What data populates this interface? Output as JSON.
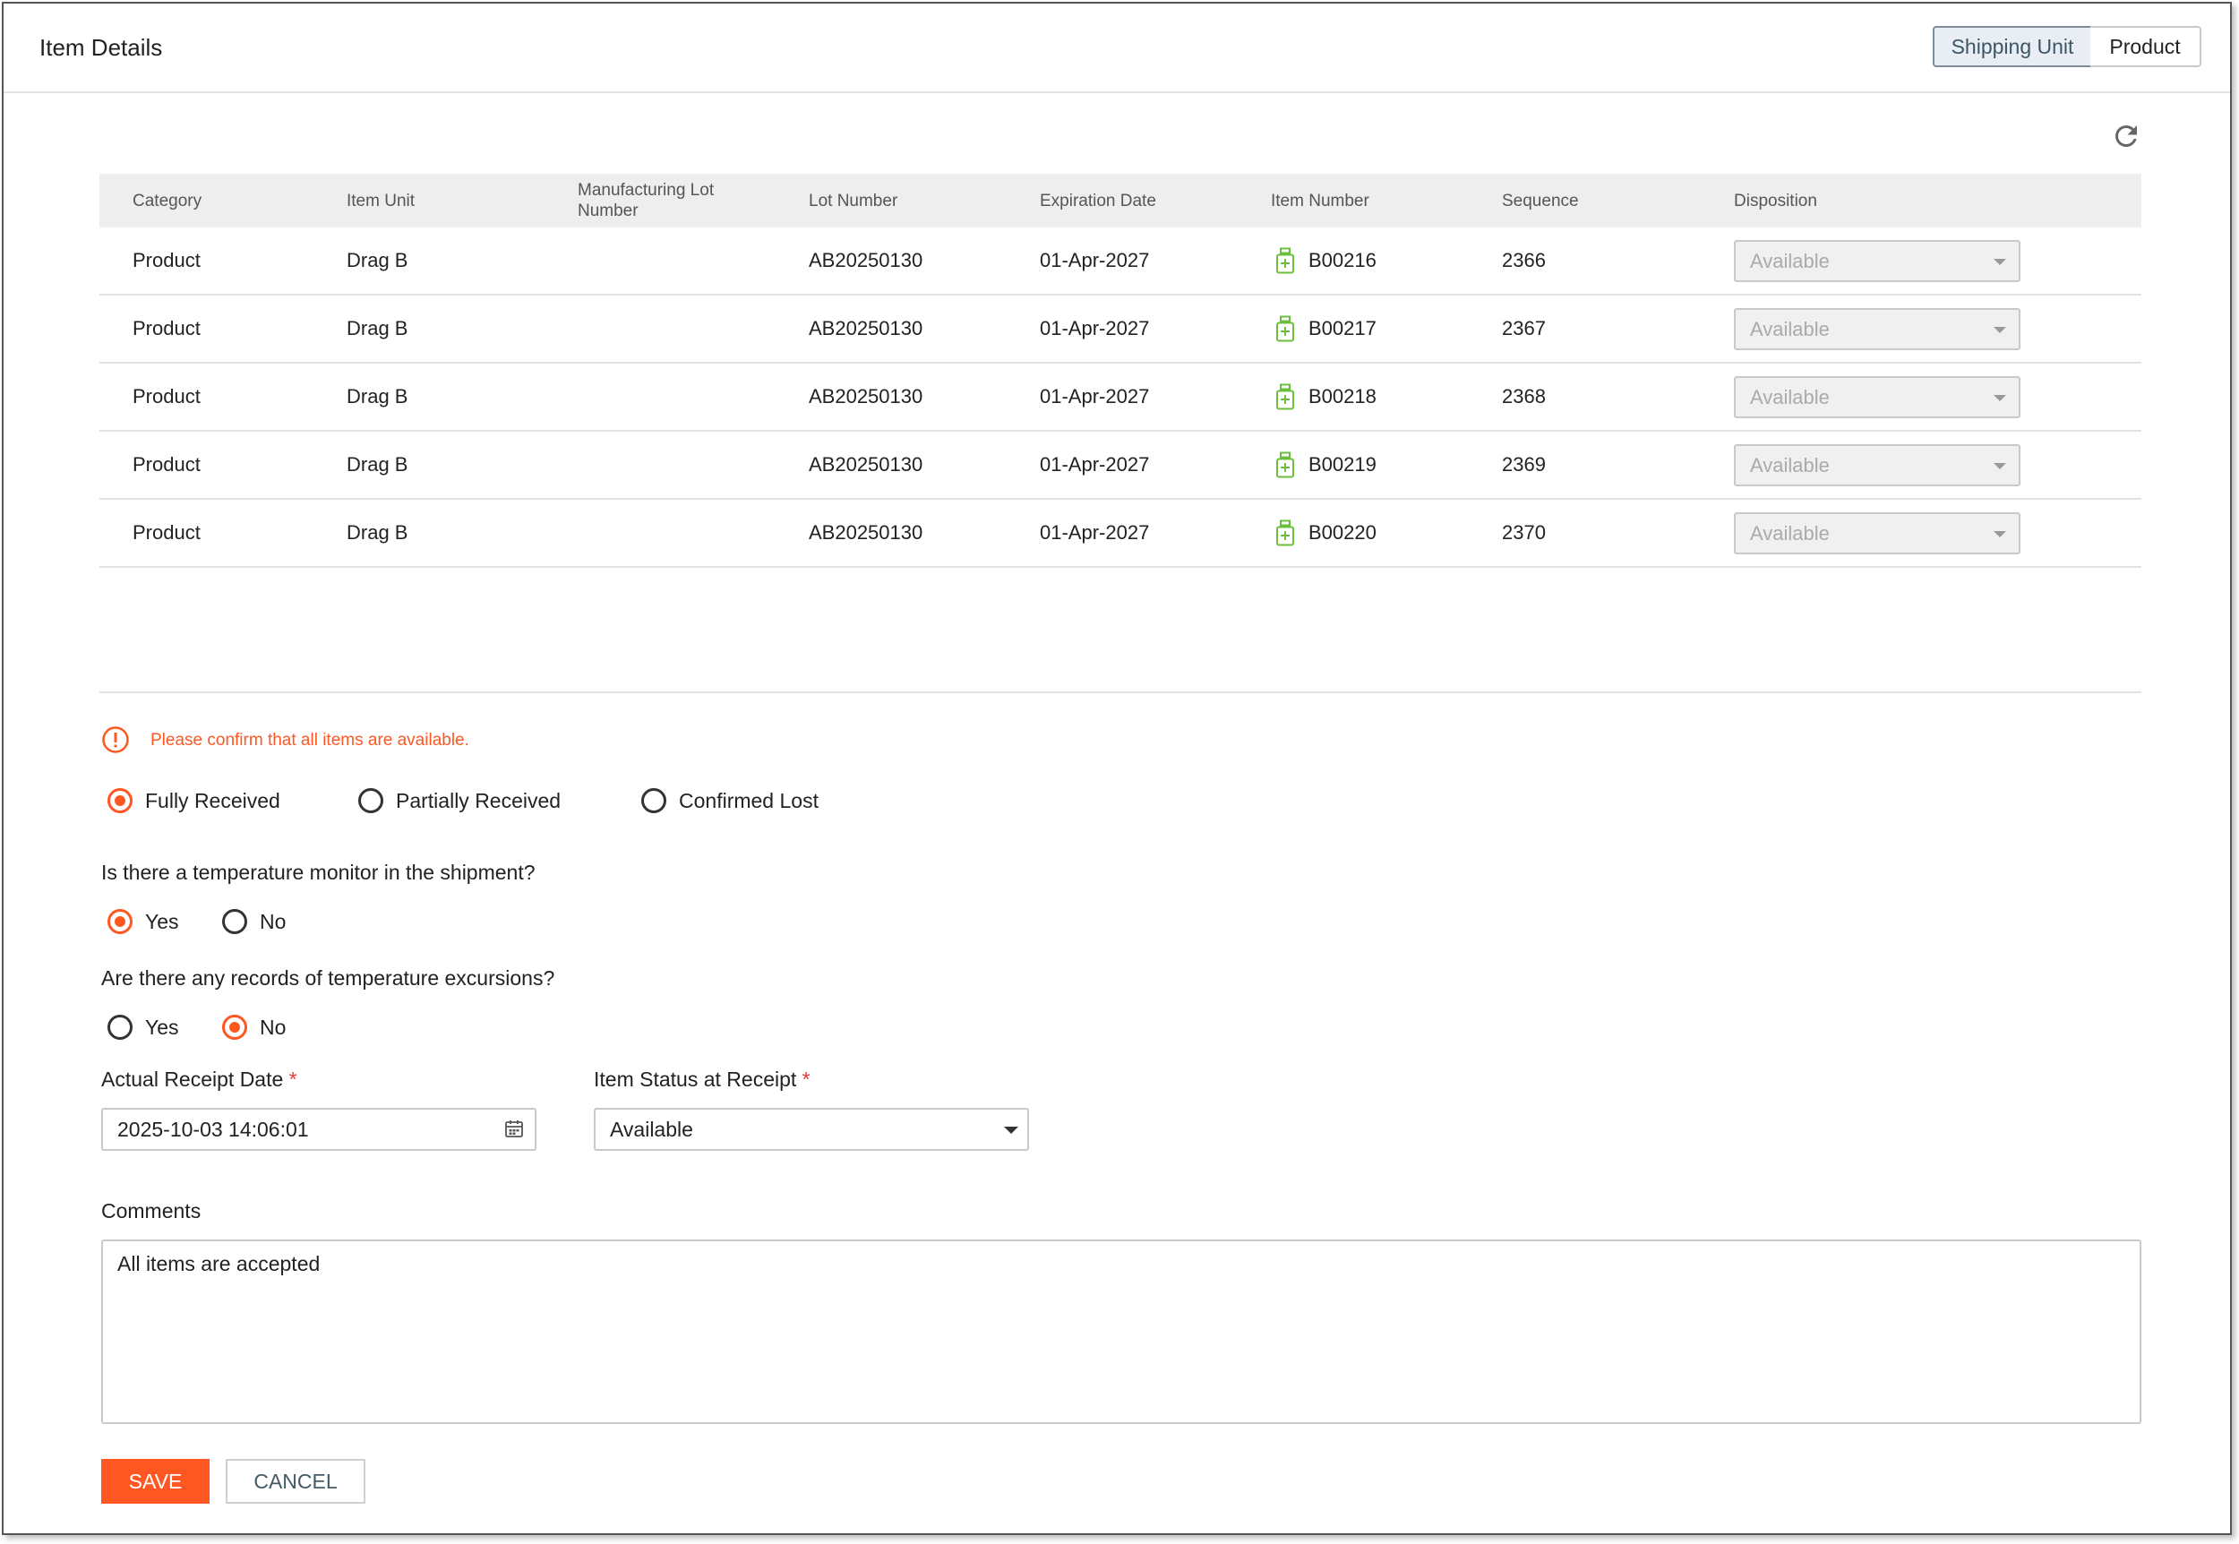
{
  "header": {
    "title": "Item Details",
    "toggle": [
      {
        "label": "Shipping Unit",
        "selected": true
      },
      {
        "label": "Product",
        "selected": false
      }
    ]
  },
  "table": {
    "columns": [
      "Category",
      "Item Unit",
      "Manufacturing Lot Number",
      "Lot Number",
      "Expiration Date",
      "Item Number",
      "Sequence",
      "Disposition"
    ],
    "rows": [
      {
        "category": "Product",
        "item_unit": "Drag B",
        "mfg_lot": "",
        "lot_number": "AB20250130",
        "expiration": "01-Apr-2027",
        "item_number": "B00216",
        "sequence": "2366",
        "disposition": "Available"
      },
      {
        "category": "Product",
        "item_unit": "Drag B",
        "mfg_lot": "",
        "lot_number": "AB20250130",
        "expiration": "01-Apr-2027",
        "item_number": "B00217",
        "sequence": "2367",
        "disposition": "Available"
      },
      {
        "category": "Product",
        "item_unit": "Drag B",
        "mfg_lot": "",
        "lot_number": "AB20250130",
        "expiration": "01-Apr-2027",
        "item_number": "B00218",
        "sequence": "2368",
        "disposition": "Available"
      },
      {
        "category": "Product",
        "item_unit": "Drag B",
        "mfg_lot": "",
        "lot_number": "AB20250130",
        "expiration": "01-Apr-2027",
        "item_number": "B00219",
        "sequence": "2369",
        "disposition": "Available"
      },
      {
        "category": "Product",
        "item_unit": "Drag B",
        "mfg_lot": "",
        "lot_number": "AB20250130",
        "expiration": "01-Apr-2027",
        "item_number": "B00220",
        "sequence": "2370",
        "disposition": "Available"
      }
    ]
  },
  "warning": "Please confirm that all items are available.",
  "receipt_status": {
    "options": [
      "Fully Received",
      "Partially Received",
      "Confirmed Lost"
    ],
    "selected": "Fully Received"
  },
  "temp_monitor": {
    "question": "Is there a temperature monitor in the shipment?",
    "options": [
      "Yes",
      "No"
    ],
    "selected": "Yes"
  },
  "temp_excursions": {
    "question": "Are there any records of temperature excursions?",
    "options": [
      "Yes",
      "No"
    ],
    "selected": "No"
  },
  "receipt_date": {
    "label": "Actual Receipt Date",
    "required_mark": "*",
    "value": "2025-10-03 14:06:01"
  },
  "item_status": {
    "label": "Item Status at Receipt",
    "required_mark": "*",
    "value": "Available"
  },
  "comments": {
    "label": "Comments",
    "value": "All items are accepted"
  },
  "buttons": {
    "save": "SAVE",
    "cancel": "CANCEL"
  },
  "colors": {
    "accent": "#ff5722",
    "item_icon": "#6cbf3c",
    "toggle_selected_bg": "#e8eef3"
  },
  "icons": {
    "refresh": "refresh-icon",
    "warning": "warning-icon",
    "item": "medicine-bottle-icon",
    "calendar": "calendar-icon",
    "dropdown": "chevron-down-icon"
  }
}
